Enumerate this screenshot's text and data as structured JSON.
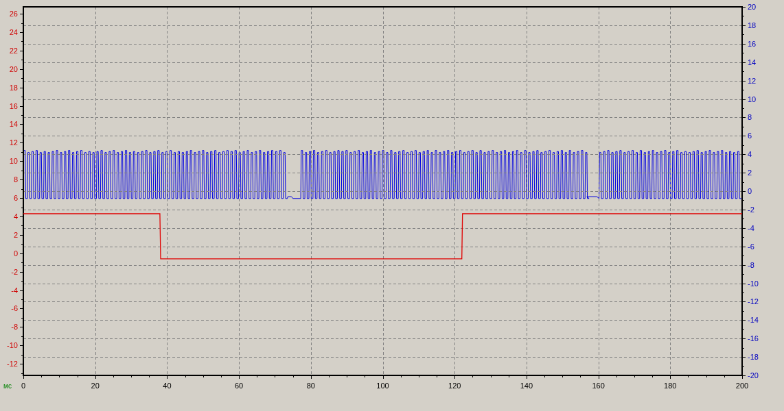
{
  "chart_data": {
    "type": "line",
    "xlabel": "мс",
    "grid": true,
    "x": [
      0,
      38,
      38.2,
      122,
      122.2,
      200
    ],
    "xlim": [
      0,
      200
    ],
    "xticks": [
      0,
      20,
      40,
      60,
      80,
      100,
      120,
      140,
      160,
      180,
      200
    ],
    "ylim": [
      -13.25,
      26.75
    ],
    "yticks": [
      -12,
      -10,
      -8,
      -6,
      -4,
      -2,
      0,
      2,
      4,
      6,
      8,
      10,
      12,
      14,
      16,
      18,
      20,
      22,
      24,
      26
    ],
    "series": [
      {
        "color": "#e00000",
        "values": [
          4.3,
          4.3,
          -0.6,
          -0.6,
          4.3,
          4.3
        ]
      }
    ]
  },
  "right_axis": {
    "tick_labels": [
      "20",
      "18",
      "16",
      "14",
      "12",
      "10",
      "8",
      "6",
      "4",
      "2",
      "0",
      "-2",
      "-4",
      "-6",
      "-8",
      "-10",
      "-12",
      "-14",
      "-16",
      "-18",
      "-20"
    ]
  }
}
